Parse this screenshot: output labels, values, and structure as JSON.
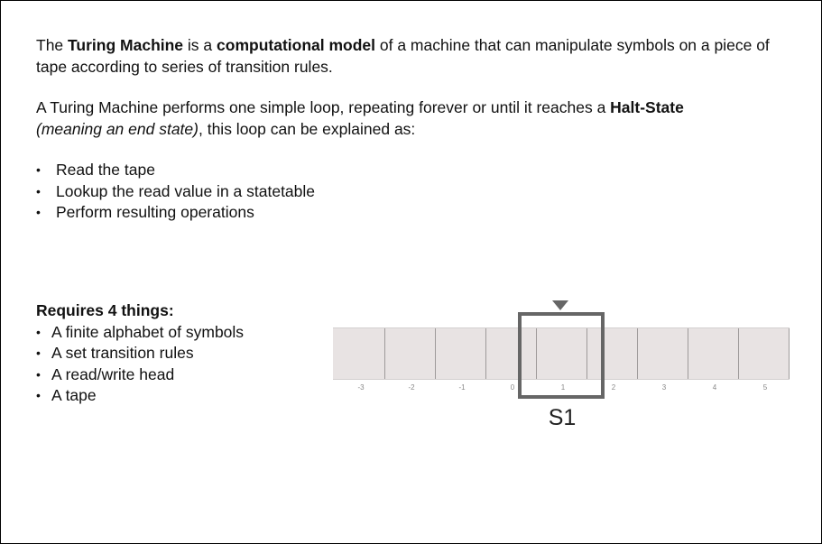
{
  "intro": {
    "p1": {
      "a": "The ",
      "b1": "Turing Machine",
      "c": " is a ",
      "b2": "computational model",
      "d": " of a machine that can manipulate symbols on a piece of tape according to series of transition rules."
    },
    "p2": {
      "a": "A Turing Machine performs one simple loop, repeating forever or until it reaches a ",
      "b": "Halt-State",
      "i": "(meaning an end state)",
      "c": ", this loop can be explained as:"
    },
    "loop_items": [
      "Read the tape",
      "Lookup the read value in a statetable",
      "Perform resulting operations"
    ]
  },
  "requirements": {
    "heading": "Requires 4 things:",
    "items": [
      "A finite alphabet of symbols",
      "A set transition rules",
      "A read/write head",
      "A tape"
    ]
  },
  "tape": {
    "indices": [
      "-3",
      "-2",
      "-1",
      "0",
      "1",
      "2",
      "3",
      "4",
      "5"
    ],
    "head_state": "S1",
    "colors": {
      "tape_fill": "#e8e3e3",
      "divider": "#9e9a9a",
      "head": "#666666"
    }
  }
}
